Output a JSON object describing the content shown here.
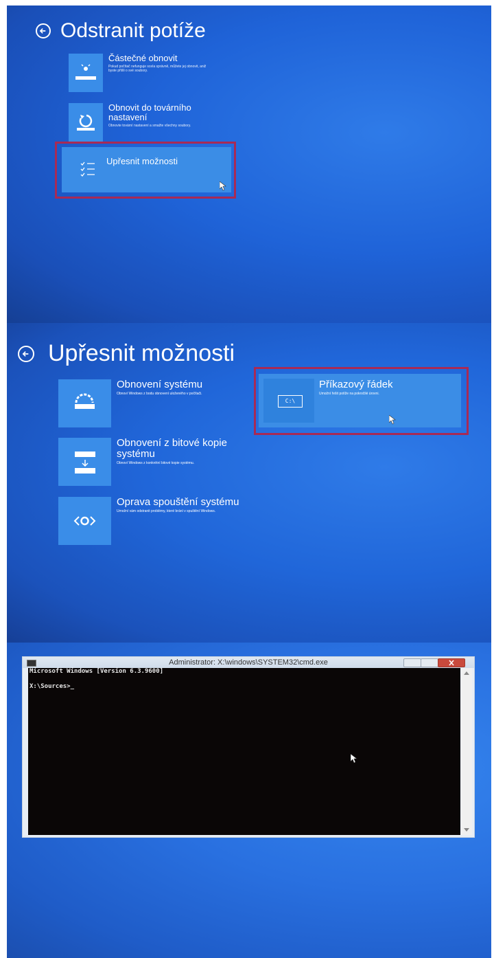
{
  "screen1": {
    "title": "Odstranit potíže",
    "tiles": [
      {
        "title": "Částečné obnovit",
        "desc": "Pokud počítač nefunguje scela správně, můžete jej obnovit, aniž byste přišli o své soubory."
      },
      {
        "title": "Obnovit do továrního nastavení",
        "desc": "Obnovte tovární nastavení a smažte všechny soubory."
      },
      {
        "title": "Upřesnit možnosti",
        "desc": ""
      }
    ]
  },
  "screen2": {
    "title": "Upřesnit možnosti",
    "tiles": [
      {
        "title": "Obnovení systému",
        "desc": "Obnoví Windows z bodu obnovení uloženého v počítači."
      },
      {
        "title": "Obnovení z bitové kopie systému",
        "desc": "Obnoví Windows z konkrétní bitové kopie systému."
      },
      {
        "title": "Oprava spouštění systému",
        "desc": "Umožní vám odstranit problémy, které brání v spuštění Windows."
      },
      {
        "title": "Příkazový řádek",
        "desc": "Umožní řešit potíže na pokročilé úrovni."
      }
    ],
    "cmd_icon_text": "C:\\"
  },
  "screen3": {
    "window_title": "Administrator: X:\\windows\\SYSTEM32\\cmd.exe",
    "console_lines": [
      "Microsoft Windows [Version 6.3.9600]",
      "",
      "X:\\Sources>_"
    ]
  },
  "colors": {
    "background": "#1f63d8",
    "tile": "#3a8de8",
    "highlight": "#a82a55",
    "console": "#0a0606"
  }
}
